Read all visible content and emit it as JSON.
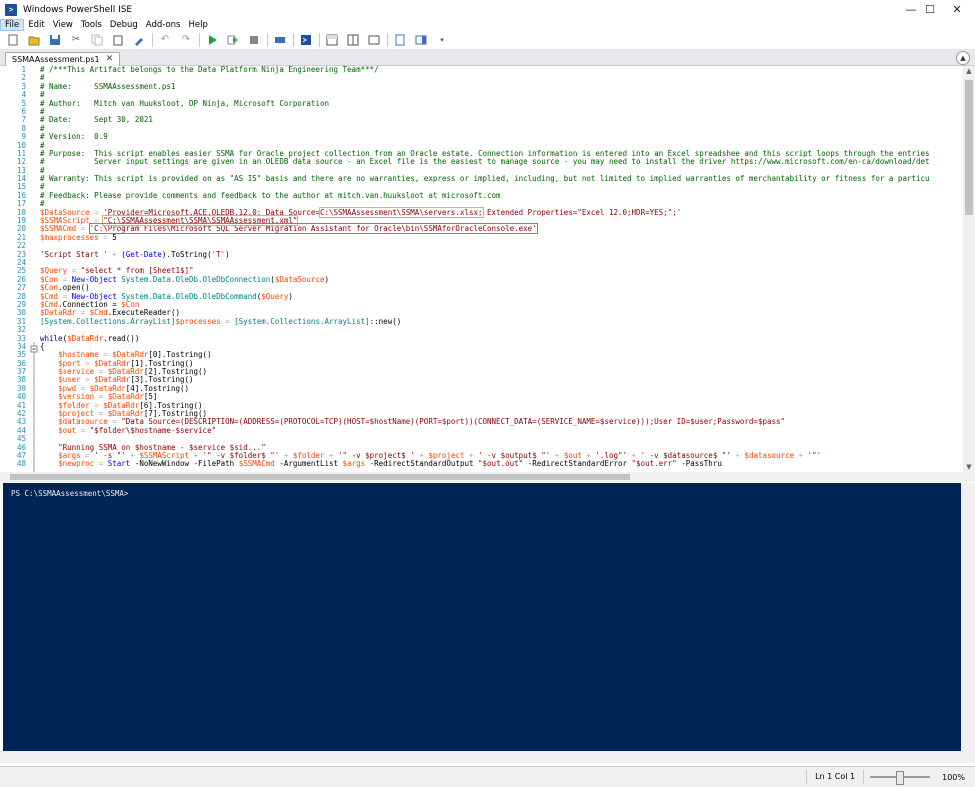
{
  "window": {
    "title": "Windows PowerShell ISE",
    "minimize": "—",
    "maximize": "☐",
    "close": "✕"
  },
  "menu": [
    "File",
    "Edit",
    "View",
    "Tools",
    "Debug",
    "Add-ons",
    "Help"
  ],
  "tab": {
    "label": "SSMAAssessment.ps1",
    "close": "✕"
  },
  "code_lines": [
    [
      [
        "c-comment",
        "# /***This Artifact belongs to the Data Platform Ninja Engineering Team***/"
      ]
    ],
    [
      [
        "c-comment",
        "#"
      ]
    ],
    [
      [
        "c-comment",
        "# Name:     SSMAAssessment.ps1"
      ]
    ],
    [
      [
        "c-comment",
        "#"
      ]
    ],
    [
      [
        "c-comment",
        "# Author:   Mitch van Huuksloot, DP Ninja, Microsoft Corporation"
      ]
    ],
    [
      [
        "c-comment",
        "#"
      ]
    ],
    [
      [
        "c-comment",
        "# Date:     Sept 30, 2021"
      ]
    ],
    [
      [
        "c-comment",
        "#"
      ]
    ],
    [
      [
        "c-comment",
        "# Version:  0.9"
      ]
    ],
    [
      [
        "c-comment",
        "#"
      ]
    ],
    [
      [
        "c-comment",
        "# Purpose:  This script enables easier SSMA for Oracle project collection from an Oracle estate. Connection information is entered into an Excel spreadshee and this script loops through the entries"
      ]
    ],
    [
      [
        "c-comment",
        "#           Server input settings are given in an OLEDB data source - an Excel file is the easiest to manage source - you may need to install the driver https://www.microsoft.com/en-ca/download/det"
      ]
    ],
    [
      [
        "c-comment",
        "#"
      ]
    ],
    [
      [
        "c-comment",
        "# Warranty: This script is provided on as \"AS IS\" basis and there are no warranties, express or implied, including, but not limited to implied warranties of merchantability or fitness for a particu"
      ]
    ],
    [
      [
        "c-comment",
        "#"
      ]
    ],
    [
      [
        "c-comment",
        "# Feedback: Please provide comments and feedback to the author at mitch.van.huuksloot at microsoft.com"
      ]
    ],
    [
      [
        "c-comment",
        "#"
      ]
    ],
    [
      [
        "c-var",
        "$DataSource"
      ],
      [
        "c-op",
        " = "
      ],
      [
        "c-str",
        "'Provider=Microsoft.ACE.OLEDB.12.0; Data Source="
      ],
      [
        "c-str hl-box",
        "C:\\SSMAAssessment\\SSMA\\servers.xlsx;"
      ],
      [
        "c-str",
        " Extended Properties=\"Excel 12.0;HDR=YES;\";'"
      ]
    ],
    [
      [
        "c-var",
        "$SSMAScript"
      ],
      [
        "c-op",
        " = "
      ],
      [
        "c-str hl-box",
        "\"C:\\SSMAAssessment\\SSMA\\SSMAAssessment.xml\""
      ]
    ],
    [
      [
        "c-var",
        "$SSMACmd"
      ],
      [
        "c-op",
        " = "
      ],
      [
        "c-str hl-box2",
        "'C:\\Program Files\\Microsoft SQL Server Migration Assistant for Oracle\\bin\\SSMAforOracleConsole.exe'"
      ]
    ],
    [
      [
        "c-var",
        "$maxprocesses"
      ],
      [
        "c-op",
        " = "
      ],
      [
        "c-plain",
        "5"
      ]
    ],
    [
      [
        "c-plain",
        ""
      ]
    ],
    [
      [
        "c-str",
        "'Script Start '"
      ],
      [
        "c-op",
        " + "
      ],
      [
        "c-plain",
        "("
      ],
      [
        "c-cmd",
        "Get-Date"
      ],
      [
        "c-plain",
        ").ToString("
      ],
      [
        "c-str",
        "'T'"
      ],
      [
        "c-plain",
        ")"
      ]
    ],
    [
      [
        "c-plain",
        ""
      ]
    ],
    [
      [
        "c-var",
        "$Query"
      ],
      [
        "c-op",
        " = "
      ],
      [
        "c-str",
        "\"select * from [Sheet1$]\""
      ]
    ],
    [
      [
        "c-var",
        "$Con"
      ],
      [
        "c-op",
        " = "
      ],
      [
        "c-cmd",
        "New-Object "
      ],
      [
        "c-type",
        "System.Data.OleDb.OleDbConnection"
      ],
      [
        "c-plain",
        "("
      ],
      [
        "c-var",
        "$DataSource"
      ],
      [
        "c-plain",
        ")"
      ]
    ],
    [
      [
        "c-var",
        "$Con"
      ],
      [
        "c-plain",
        ".open()"
      ]
    ],
    [
      [
        "c-var",
        "$Cmd"
      ],
      [
        "c-op",
        " = "
      ],
      [
        "c-cmd",
        "New-Object "
      ],
      [
        "c-type",
        "System.Data.OleDb.OleDbCommand"
      ],
      [
        "c-plain",
        "("
      ],
      [
        "c-var",
        "$Query"
      ],
      [
        "c-plain",
        ")"
      ]
    ],
    [
      [
        "c-var",
        "$Cmd"
      ],
      [
        "c-plain",
        ".Connection = "
      ],
      [
        "c-var",
        "$Con"
      ]
    ],
    [
      [
        "c-var",
        "$DataRdr"
      ],
      [
        "c-op",
        " = "
      ],
      [
        "c-var",
        "$Cmd"
      ],
      [
        "c-plain",
        ".ExecuteReader()"
      ]
    ],
    [
      [
        "c-type",
        "[System.Collections.ArrayList]"
      ],
      [
        "c-var",
        "$processes"
      ],
      [
        "c-op",
        " = "
      ],
      [
        "c-type",
        "[System.Collections.ArrayList]"
      ],
      [
        "c-plain",
        "::new()"
      ]
    ],
    [
      [
        "c-plain",
        ""
      ]
    ],
    [
      [
        "c-kw",
        "while"
      ],
      [
        "c-plain",
        "("
      ],
      [
        "c-var",
        "$DataRdr"
      ],
      [
        "c-plain",
        ".read())"
      ]
    ],
    [
      [
        "c-plain",
        "{"
      ]
    ],
    [
      [
        "c-plain",
        "    "
      ],
      [
        "c-var",
        "$hostname"
      ],
      [
        "c-op",
        " = "
      ],
      [
        "c-var",
        "$DataRdr"
      ],
      [
        "c-plain",
        "["
      ],
      [
        "c-plain",
        "0"
      ],
      [
        "c-plain",
        "].Tostring()"
      ]
    ],
    [
      [
        "c-plain",
        "    "
      ],
      [
        "c-var",
        "$port"
      ],
      [
        "c-op",
        " = "
      ],
      [
        "c-var",
        "$DataRdr"
      ],
      [
        "c-plain",
        "[1].Tostring()"
      ]
    ],
    [
      [
        "c-plain",
        "    "
      ],
      [
        "c-var",
        "$service"
      ],
      [
        "c-op",
        " = "
      ],
      [
        "c-var",
        "$DataRdr"
      ],
      [
        "c-plain",
        "[2].Tostring()"
      ]
    ],
    [
      [
        "c-plain",
        "    "
      ],
      [
        "c-var",
        "$user"
      ],
      [
        "c-op",
        " = "
      ],
      [
        "c-var",
        "$DataRdr"
      ],
      [
        "c-plain",
        "[3].Tostring()"
      ]
    ],
    [
      [
        "c-plain",
        "    "
      ],
      [
        "c-var",
        "$pwd"
      ],
      [
        "c-op",
        " = "
      ],
      [
        "c-var",
        "$DataRdr"
      ],
      [
        "c-plain",
        "[4].Tostring()"
      ]
    ],
    [
      [
        "c-plain",
        "    "
      ],
      [
        "c-var",
        "$version"
      ],
      [
        "c-op",
        " = "
      ],
      [
        "c-var",
        "$DataRdr"
      ],
      [
        "c-plain",
        "[5]"
      ]
    ],
    [
      [
        "c-plain",
        "    "
      ],
      [
        "c-var",
        "$folder"
      ],
      [
        "c-op",
        " = "
      ],
      [
        "c-var",
        "$DataRdr"
      ],
      [
        "c-plain",
        "[6].Tostring()"
      ]
    ],
    [
      [
        "c-plain",
        "    "
      ],
      [
        "c-var",
        "$project"
      ],
      [
        "c-op",
        " = "
      ],
      [
        "c-var",
        "$DataRdr"
      ],
      [
        "c-plain",
        "[7].Tostring()"
      ]
    ],
    [
      [
        "c-plain",
        "    "
      ],
      [
        "c-var",
        "$datasource"
      ],
      [
        "c-op",
        " = "
      ],
      [
        "c-str",
        "\"Data Source=(DESCRIPTION=(ADDRESS=(PROTOCOL=TCP)(HOST=$hostName)(PORT=$port))(CONNECT_DATA=(SERVICE_NAME=$service)));User ID=$user;Password=$pass\""
      ]
    ],
    [
      [
        "c-plain",
        "    "
      ],
      [
        "c-var",
        "$out"
      ],
      [
        "c-op",
        " = "
      ],
      [
        "c-str",
        "\"$folder\\$hostname-$service\""
      ]
    ],
    [
      [
        "c-plain",
        ""
      ]
    ],
    [
      [
        "c-plain",
        "    "
      ],
      [
        "c-str",
        "\"Running SSMA on $hostname - $service $sid...\""
      ]
    ],
    [
      [
        "c-plain",
        "    "
      ],
      [
        "c-var",
        "$args"
      ],
      [
        "c-op",
        " = "
      ],
      [
        "c-str",
        "' -s \"'"
      ],
      [
        "c-op",
        " + "
      ],
      [
        "c-var",
        "$SSMAScript"
      ],
      [
        "c-op",
        " + "
      ],
      [
        "c-str",
        "'\" -v $folder$ \"'"
      ],
      [
        "c-op",
        " + "
      ],
      [
        "c-var",
        "$folder"
      ],
      [
        "c-op",
        " + "
      ],
      [
        "c-str",
        "'\" -v $project$ '"
      ],
      [
        "c-op",
        " + "
      ],
      [
        "c-var",
        "$project"
      ],
      [
        "c-op",
        " + "
      ],
      [
        "c-str",
        "' -v $output$ \"'"
      ],
      [
        "c-op",
        " + "
      ],
      [
        "c-var",
        "$out"
      ],
      [
        "c-op",
        " + "
      ],
      [
        "c-str",
        "'.log\"'"
      ],
      [
        "c-op",
        " + "
      ],
      [
        "c-str",
        "' -v $datasource$ \"'"
      ],
      [
        "c-op",
        " + "
      ],
      [
        "c-var",
        "$datasource"
      ],
      [
        "c-op",
        " + "
      ],
      [
        "c-str",
        "'\"'"
      ]
    ],
    [
      [
        "c-plain",
        "    "
      ],
      [
        "c-var",
        "$newproc"
      ],
      [
        "c-op",
        " = "
      ],
      [
        "c-cmd",
        "Start"
      ],
      [
        "c-plain",
        " -NoNewWindow -FilePath "
      ],
      [
        "c-var",
        "$SSMACmd"
      ],
      [
        "c-plain",
        " -ArgumentList "
      ],
      [
        "c-var",
        "$args"
      ],
      [
        "c-plain",
        " -RedirectStandardOutput "
      ],
      [
        "c-str",
        "\"$out.out\""
      ],
      [
        "c-plain",
        " -RedirectStandardError "
      ],
      [
        "c-str",
        "\"$out.err\""
      ],
      [
        "c-plain",
        " -PassThru"
      ]
    ]
  ],
  "console": {
    "prompt": "PS C:\\SSMAAssessment\\SSMA>"
  },
  "status": {
    "position": "Ln 1  Col 1",
    "zoom": "100%",
    "zoom_level_percent": 100
  }
}
